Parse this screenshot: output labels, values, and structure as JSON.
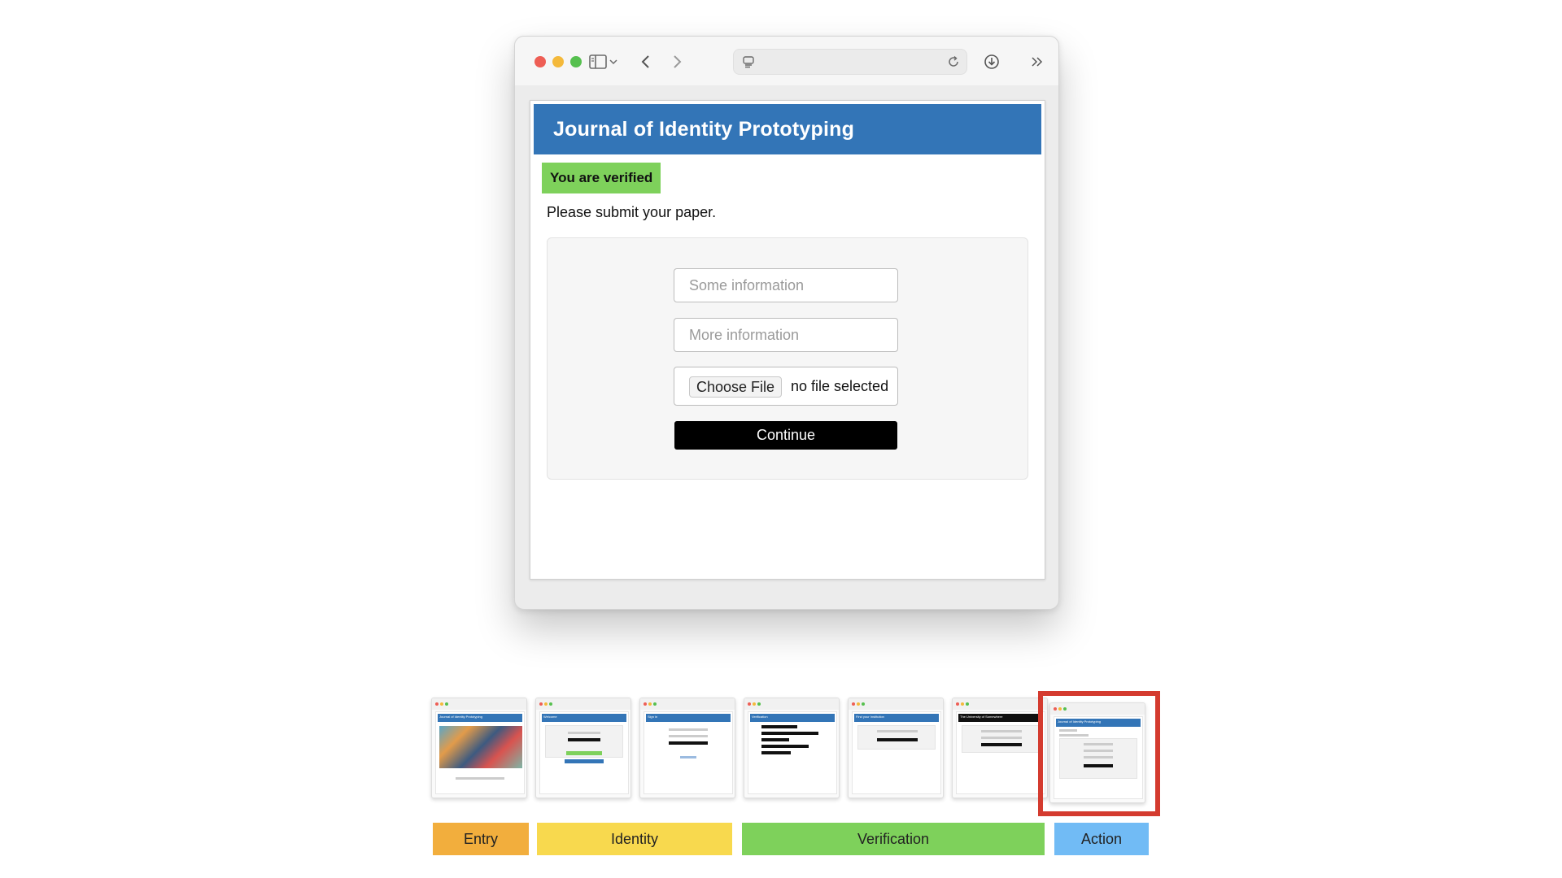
{
  "page": {
    "header_title": "Journal of Identity Prototyping",
    "badge": "You are verified",
    "subtitle": "Please submit your paper.",
    "form": {
      "field1_placeholder": "Some information",
      "field2_placeholder": "More information",
      "file_button": "Choose File",
      "file_status": "no file selected",
      "continue_label": "Continue"
    }
  },
  "colors": {
    "header": "#3375b7",
    "badge": "#7ed15b",
    "highlight": "#d43b2f",
    "entry": "#f2ae3d",
    "identity": "#f8d94e",
    "verification": "#7ed15b",
    "action": "#71bbf5"
  },
  "icons": [
    "sidebar-icon",
    "chevron-down-icon",
    "back-icon",
    "forward-icon",
    "page-icon",
    "reload-icon",
    "download-icon",
    "more-icon"
  ],
  "thumbnails": [
    "Journal of Identity Prototyping",
    "Welcome",
    "Sign in",
    "Verification",
    "Find your Institution",
    "The University of Somewhere",
    "Journal of Identity Prototyping"
  ],
  "stages": {
    "entry": "Entry",
    "identity": "Identity",
    "verification": "Verification",
    "action": "Action"
  },
  "current_step": 7
}
